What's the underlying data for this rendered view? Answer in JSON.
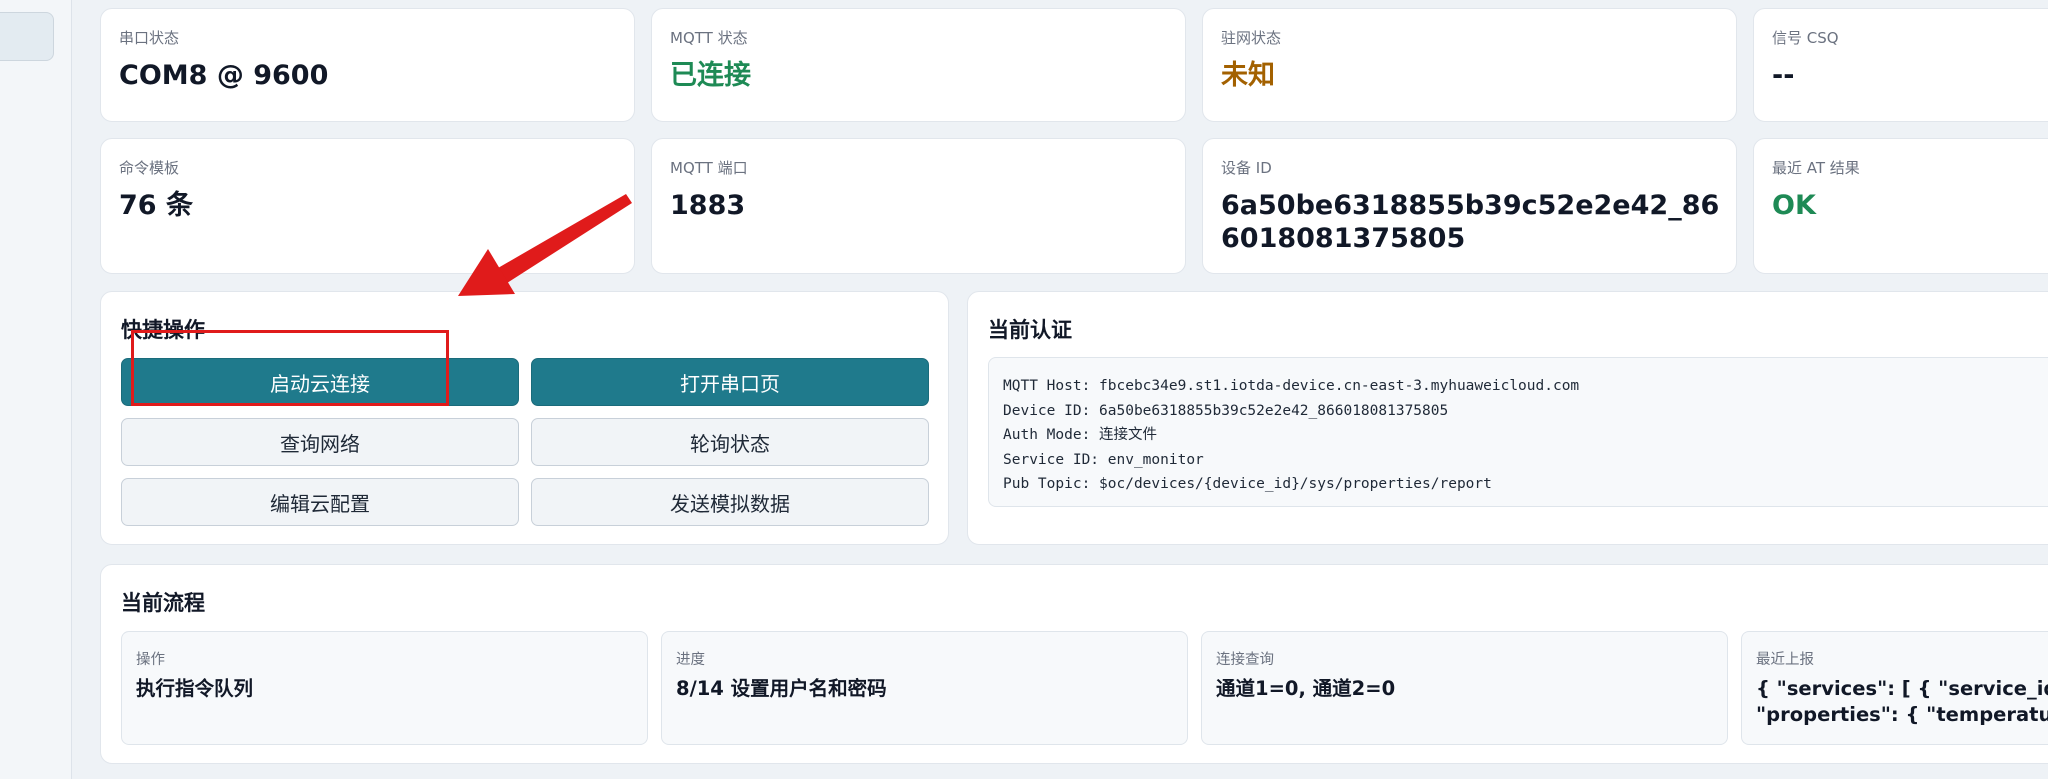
{
  "stats": [
    {
      "label": "串口状态",
      "value": "COM8 @ 9600",
      "tone": "default"
    },
    {
      "label": "MQTT 状态",
      "value": "已连接",
      "tone": "green"
    },
    {
      "label": "驻网状态",
      "value": "未知",
      "tone": "amber"
    },
    {
      "label": "信号 CSQ",
      "value": "--",
      "tone": "default"
    },
    {
      "label": "命令模板",
      "value": "76 条",
      "tone": "default"
    },
    {
      "label": "MQTT 端口",
      "value": "1883",
      "tone": "default"
    },
    {
      "label": "设备 ID",
      "value": "6a50be6318855b39c52e2e42_866018081375805",
      "tone": "default"
    },
    {
      "label": "最近 AT 结果",
      "value": "OK",
      "tone": "green"
    }
  ],
  "quick_actions": {
    "title": "快捷操作",
    "buttons": [
      "启动云连接",
      "打开串口页",
      "查询网络",
      "轮询状态",
      "编辑云配置",
      "发送模拟数据"
    ]
  },
  "auth": {
    "title": "当前认证",
    "lines": [
      "MQTT Host: fbcebc34e9.st1.iotda-device.cn-east-3.myhuaweicloud.com",
      "Device ID: 6a50be6318855b39c52e2e42_866018081375805",
      "Auth Mode: 连接文件",
      "Service ID: env_monitor",
      "Pub Topic: $oc/devices/{device_id}/sys/properties/report"
    ]
  },
  "flow": {
    "title": "当前流程",
    "items": [
      {
        "label": "操作",
        "value": "执行指令队列"
      },
      {
        "label": "进度",
        "value": "8/14 设置用户名和密码"
      },
      {
        "label": "连接查询",
        "value": "通道1=0, 通道2=0"
      },
      {
        "label": "最近上报",
        "value": "{ \"services\": [ { \"service_id\": \"\n\"properties\": { \"temperature\""
      }
    ]
  },
  "colors": {
    "primary": "#1f7a8c",
    "green": "#1e8a55",
    "amber": "#a36100",
    "annotation_red": "#e01b1b"
  }
}
